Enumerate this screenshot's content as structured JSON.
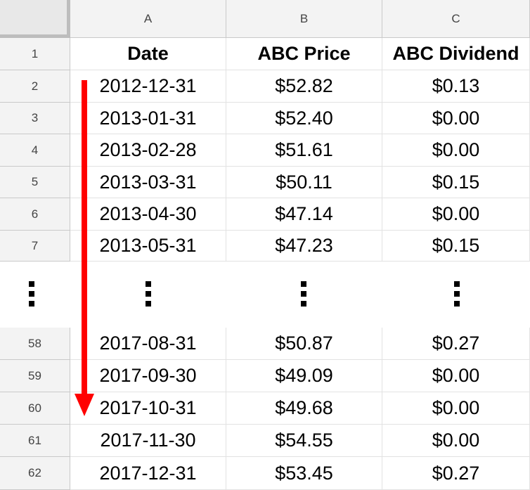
{
  "columns": [
    "A",
    "B",
    "C"
  ],
  "header_row": {
    "num": "1",
    "date": "Date",
    "price": "ABC Price",
    "dividend": "ABC Dividend"
  },
  "top_rows": [
    {
      "num": "2",
      "date": "2012-12-31",
      "price": "$52.82",
      "dividend": "$0.13"
    },
    {
      "num": "3",
      "date": "2013-01-31",
      "price": "$52.40",
      "dividend": "$0.00"
    },
    {
      "num": "4",
      "date": "2013-02-28",
      "price": "$51.61",
      "dividend": "$0.00"
    },
    {
      "num": "5",
      "date": "2013-03-31",
      "price": "$50.11",
      "dividend": "$0.15"
    },
    {
      "num": "6",
      "date": "2013-04-30",
      "price": "$47.14",
      "dividend": "$0.00"
    },
    {
      "num": "7",
      "date": "2013-05-31",
      "price": "$47.23",
      "dividend": "$0.15"
    }
  ],
  "bottom_rows": [
    {
      "num": "58",
      "date": "2017-08-31",
      "price": "$50.87",
      "dividend": "$0.27"
    },
    {
      "num": "59",
      "date": "2017-09-30",
      "price": "$49.09",
      "dividend": "$0.00"
    },
    {
      "num": "60",
      "date": "2017-10-31",
      "price": "$49.68",
      "dividend": "$0.00"
    },
    {
      "num": "61",
      "date": "2017-11-30",
      "price": "$54.55",
      "dividend": "$0.00"
    },
    {
      "num": "62",
      "date": "2017-12-31",
      "price": "$53.45",
      "dividend": "$0.27"
    }
  ],
  "colors": {
    "arrow": "#ff0000",
    "header_bg": "#f3f3f3"
  }
}
